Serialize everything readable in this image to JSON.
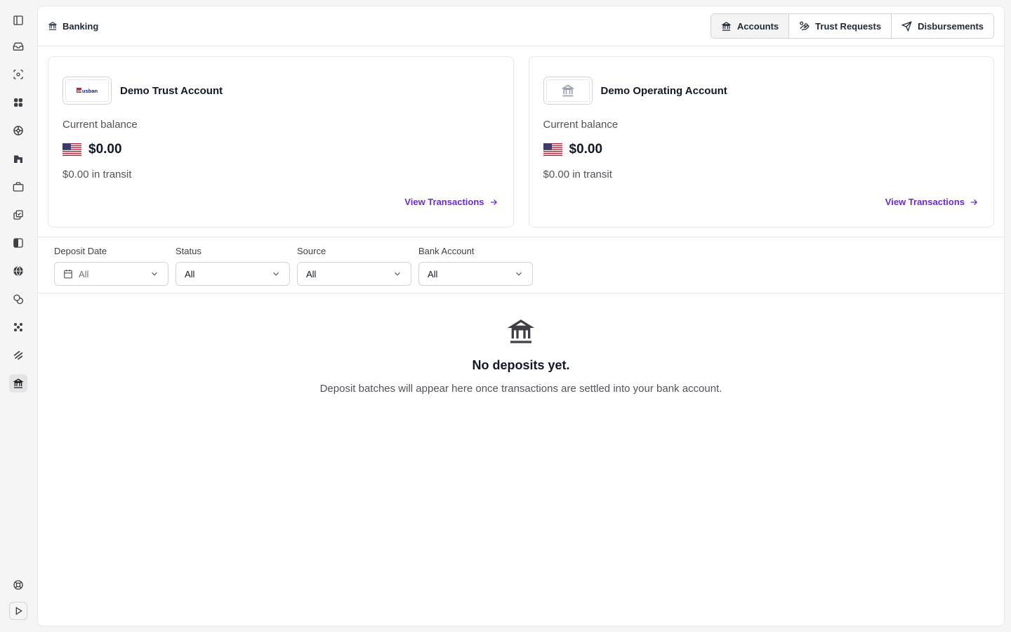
{
  "rail": {
    "items": [
      {
        "icon": "sidebar-toggle-icon"
      },
      {
        "icon": "inbox-icon"
      },
      {
        "icon": "scan-icon"
      },
      {
        "icon": "grid-blocks-icon"
      },
      {
        "icon": "network-icon"
      },
      {
        "icon": "chart-icon"
      },
      {
        "icon": "briefcase-icon"
      },
      {
        "icon": "tasks-icon"
      },
      {
        "icon": "panel-icon"
      },
      {
        "icon": "globe-icon"
      },
      {
        "icon": "coins-icon"
      },
      {
        "icon": "apps-icon"
      },
      {
        "icon": "stripes-icon"
      },
      {
        "icon": "bank-icon",
        "active": true
      }
    ],
    "bottom": [
      {
        "icon": "help-icon"
      },
      {
        "icon": "play-icon"
      }
    ]
  },
  "header": {
    "breadcrumb": "Banking",
    "tabs": [
      {
        "label": "Accounts",
        "icon": "bank-icon",
        "active": true
      },
      {
        "label": "Trust Requests",
        "icon": "hand-coins-icon"
      },
      {
        "label": "Disbursements",
        "icon": "send-icon"
      }
    ]
  },
  "accounts": [
    {
      "name": "Demo Trust Account",
      "logo": "us-bank-logo",
      "logo_text": "usbank",
      "balance_label": "Current balance",
      "currency_flag": "us-flag-icon",
      "balance": "$0.00",
      "transit": "$0.00 in transit",
      "link": "View Transactions"
    },
    {
      "name": "Demo Operating Account",
      "logo": "bank-icon",
      "balance_label": "Current balance",
      "currency_flag": "us-flag-icon",
      "balance": "$0.00",
      "transit": "$0.00 in transit",
      "link": "View Transactions"
    }
  ],
  "filters": [
    {
      "label": "Deposit Date",
      "value": "All",
      "icon": "calendar-icon"
    },
    {
      "label": "Status",
      "value": "All"
    },
    {
      "label": "Source",
      "value": "All"
    },
    {
      "label": "Bank Account",
      "value": "All"
    }
  ],
  "empty": {
    "title": "No deposits yet.",
    "text": "Deposit batches will appear here once transactions are settled into your bank account."
  },
  "colors": {
    "accent": "#6d28d9",
    "border": "#e5e7eb",
    "background": "#f5f5f5"
  }
}
